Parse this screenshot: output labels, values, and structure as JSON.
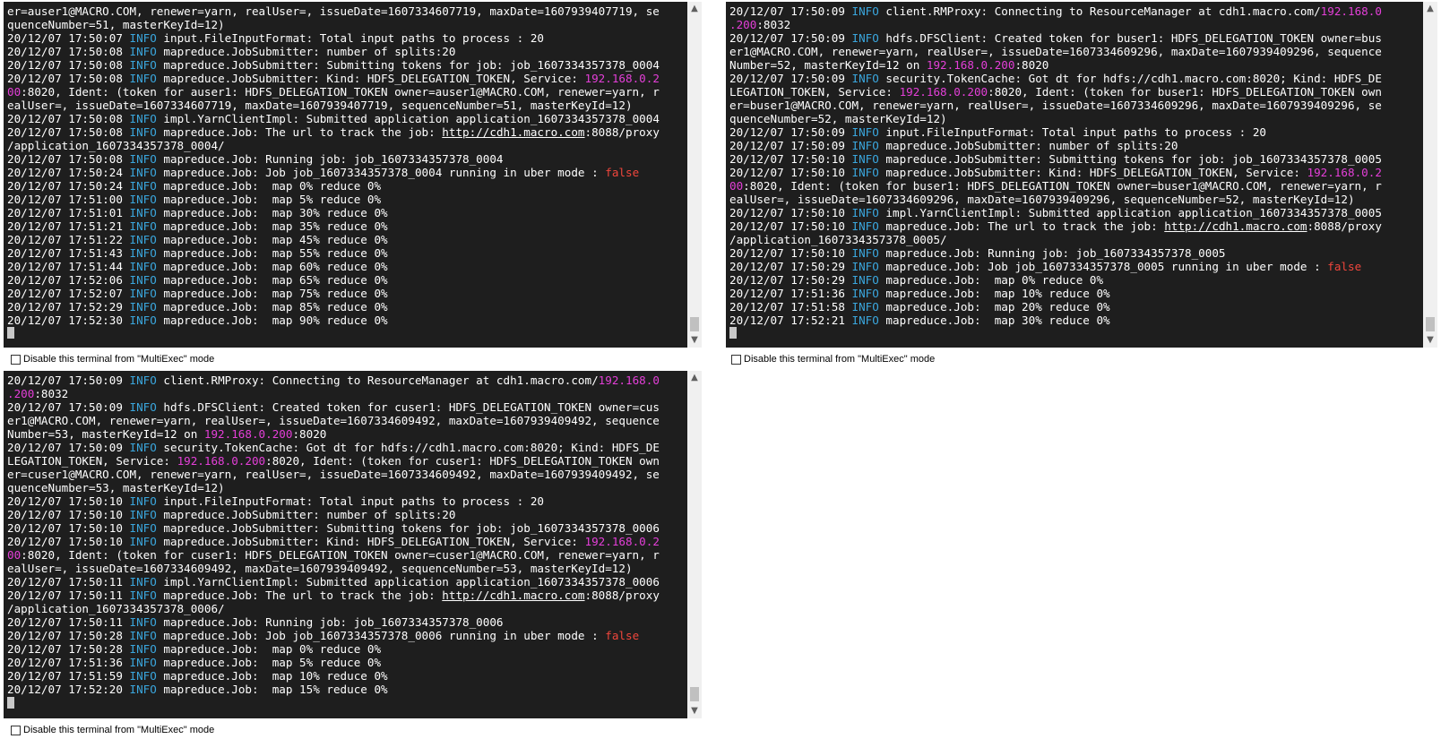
{
  "checkbox_label": "Disable this terminal from \"MultiExec\" mode",
  "terminals": [
    {
      "name": "terminal-1",
      "lines": [
        [
          [
            "t",
            "er=auser1@MACRO.COM, renewer=yarn, realUser=, issueDate=1607334607719, maxDate=1607939407719, se"
          ]
        ],
        [
          [
            "t",
            "quenceNumber=51, masterKeyId=12)"
          ]
        ],
        [
          [
            "t",
            "20/12/07 17:50:07 "
          ],
          [
            "i",
            "INFO"
          ],
          [
            "t",
            " input.FileInputFormat: Total input paths to process : 20"
          ]
        ],
        [
          [
            "t",
            "20/12/07 17:50:08 "
          ],
          [
            "i",
            "INFO"
          ],
          [
            "t",
            " mapreduce.JobSubmitter: number of splits:20"
          ]
        ],
        [
          [
            "t",
            "20/12/07 17:50:08 "
          ],
          [
            "i",
            "INFO"
          ],
          [
            "t",
            " mapreduce.JobSubmitter: Submitting tokens for job: job_1607334357378_0004"
          ]
        ],
        [
          [
            "t",
            "20/12/07 17:50:08 "
          ],
          [
            "i",
            "INFO"
          ],
          [
            "t",
            " mapreduce.JobSubmitter: Kind: HDFS_DELEGATION_TOKEN, Service: "
          ],
          [
            "p",
            "192.168.0.2"
          ]
        ],
        [
          [
            "p",
            "00"
          ],
          [
            "t",
            ":8020, Ident: (token for auser1: HDFS_DELEGATION_TOKEN owner=auser1@MACRO.COM, renewer=yarn, r"
          ]
        ],
        [
          [
            "t",
            "ealUser=, issueDate=1607334607719, maxDate=1607939407719, sequenceNumber=51, masterKeyId=12)"
          ]
        ],
        [
          [
            "t",
            "20/12/07 17:50:08 "
          ],
          [
            "i",
            "INFO"
          ],
          [
            "t",
            " impl.YarnClientImpl: Submitted application application_1607334357378_0004"
          ]
        ],
        [
          [
            "t",
            "20/12/07 17:50:08 "
          ],
          [
            "i",
            "INFO"
          ],
          [
            "t",
            " mapreduce.Job: The url to track the job: "
          ],
          [
            "u",
            "http://cdh1.macro.com"
          ],
          [
            "t",
            ":8088/proxy"
          ]
        ],
        [
          [
            "t",
            "/application_1607334357378_0004/"
          ]
        ],
        [
          [
            "t",
            "20/12/07 17:50:08 "
          ],
          [
            "i",
            "INFO"
          ],
          [
            "t",
            " mapreduce.Job: Running job: job_1607334357378_0004"
          ]
        ],
        [
          [
            "t",
            "20/12/07 17:50:24 "
          ],
          [
            "i",
            "INFO"
          ],
          [
            "t",
            " mapreduce.Job: Job job_1607334357378_0004 running in uber mode : "
          ],
          [
            "f",
            "false"
          ]
        ],
        [
          [
            "t",
            "20/12/07 17:50:24 "
          ],
          [
            "i",
            "INFO"
          ],
          [
            "t",
            " mapreduce.Job:  map 0% reduce 0%"
          ]
        ],
        [
          [
            "t",
            "20/12/07 17:51:00 "
          ],
          [
            "i",
            "INFO"
          ],
          [
            "t",
            " mapreduce.Job:  map 5% reduce 0%"
          ]
        ],
        [
          [
            "t",
            "20/12/07 17:51:01 "
          ],
          [
            "i",
            "INFO"
          ],
          [
            "t",
            " mapreduce.Job:  map 30% reduce 0%"
          ]
        ],
        [
          [
            "t",
            "20/12/07 17:51:21 "
          ],
          [
            "i",
            "INFO"
          ],
          [
            "t",
            " mapreduce.Job:  map 35% reduce 0%"
          ]
        ],
        [
          [
            "t",
            "20/12/07 17:51:22 "
          ],
          [
            "i",
            "INFO"
          ],
          [
            "t",
            " mapreduce.Job:  map 45% reduce 0%"
          ]
        ],
        [
          [
            "t",
            "20/12/07 17:51:43 "
          ],
          [
            "i",
            "INFO"
          ],
          [
            "t",
            " mapreduce.Job:  map 55% reduce 0%"
          ]
        ],
        [
          [
            "t",
            "20/12/07 17:51:44 "
          ],
          [
            "i",
            "INFO"
          ],
          [
            "t",
            " mapreduce.Job:  map 60% reduce 0%"
          ]
        ],
        [
          [
            "t",
            "20/12/07 17:52:06 "
          ],
          [
            "i",
            "INFO"
          ],
          [
            "t",
            " mapreduce.Job:  map 65% reduce 0%"
          ]
        ],
        [
          [
            "t",
            "20/12/07 17:52:07 "
          ],
          [
            "i",
            "INFO"
          ],
          [
            "t",
            " mapreduce.Job:  map 75% reduce 0%"
          ]
        ],
        [
          [
            "t",
            "20/12/07 17:52:29 "
          ],
          [
            "i",
            "INFO"
          ],
          [
            "t",
            " mapreduce.Job:  map 85% reduce 0%"
          ]
        ],
        [
          [
            "t",
            "20/12/07 17:52:30 "
          ],
          [
            "i",
            "INFO"
          ],
          [
            "t",
            " mapreduce.Job:  map 90% reduce 0%"
          ]
        ]
      ]
    },
    {
      "name": "terminal-2",
      "lines": [
        [
          [
            "t",
            "20/12/07 17:50:09 "
          ],
          [
            "i",
            "INFO"
          ],
          [
            "t",
            " client.RMProxy: Connecting to ResourceManager at cdh1.macro.com/"
          ],
          [
            "p",
            "192.168.0"
          ]
        ],
        [
          [
            "p",
            ".200"
          ],
          [
            "t",
            ":8032"
          ]
        ],
        [
          [
            "t",
            "20/12/07 17:50:09 "
          ],
          [
            "i",
            "INFO"
          ],
          [
            "t",
            " hdfs.DFSClient: Created token for buser1: HDFS_DELEGATION_TOKEN owner=bus"
          ]
        ],
        [
          [
            "t",
            "er1@MACRO.COM, renewer=yarn, realUser=, issueDate=1607334609296, maxDate=1607939409296, sequence"
          ]
        ],
        [
          [
            "t",
            "Number=52, masterKeyId=12 on "
          ],
          [
            "p",
            "192.168.0.200"
          ],
          [
            "t",
            ":8020"
          ]
        ],
        [
          [
            "t",
            "20/12/07 17:50:09 "
          ],
          [
            "i",
            "INFO"
          ],
          [
            "t",
            " security.TokenCache: Got dt for hdfs://cdh1.macro.com:8020; Kind: HDFS_DE"
          ]
        ],
        [
          [
            "t",
            "LEGATION_TOKEN, Service: "
          ],
          [
            "p",
            "192.168.0.200"
          ],
          [
            "t",
            ":8020, Ident: (token for buser1: HDFS_DELEGATION_TOKEN own"
          ]
        ],
        [
          [
            "t",
            "er=buser1@MACRO.COM, renewer=yarn, realUser=, issueDate=1607334609296, maxDate=1607939409296, se"
          ]
        ],
        [
          [
            "t",
            "quenceNumber=52, masterKeyId=12)"
          ]
        ],
        [
          [
            "t",
            "20/12/07 17:50:09 "
          ],
          [
            "i",
            "INFO"
          ],
          [
            "t",
            " input.FileInputFormat: Total input paths to process : 20"
          ]
        ],
        [
          [
            "t",
            "20/12/07 17:50:09 "
          ],
          [
            "i",
            "INFO"
          ],
          [
            "t",
            " mapreduce.JobSubmitter: number of splits:20"
          ]
        ],
        [
          [
            "t",
            "20/12/07 17:50:10 "
          ],
          [
            "i",
            "INFO"
          ],
          [
            "t",
            " mapreduce.JobSubmitter: Submitting tokens for job: job_1607334357378_0005"
          ]
        ],
        [
          [
            "t",
            "20/12/07 17:50:10 "
          ],
          [
            "i",
            "INFO"
          ],
          [
            "t",
            " mapreduce.JobSubmitter: Kind: HDFS_DELEGATION_TOKEN, Service: "
          ],
          [
            "p",
            "192.168.0.2"
          ]
        ],
        [
          [
            "p",
            "00"
          ],
          [
            "t",
            ":8020, Ident: (token for buser1: HDFS_DELEGATION_TOKEN owner=buser1@MACRO.COM, renewer=yarn, r"
          ]
        ],
        [
          [
            "t",
            "ealUser=, issueDate=1607334609296, maxDate=1607939409296, sequenceNumber=52, masterKeyId=12)"
          ]
        ],
        [
          [
            "t",
            "20/12/07 17:50:10 "
          ],
          [
            "i",
            "INFO"
          ],
          [
            "t",
            " impl.YarnClientImpl: Submitted application application_1607334357378_0005"
          ]
        ],
        [
          [
            "t",
            "20/12/07 17:50:10 "
          ],
          [
            "i",
            "INFO"
          ],
          [
            "t",
            " mapreduce.Job: The url to track the job: "
          ],
          [
            "u",
            "http://cdh1.macro.com"
          ],
          [
            "t",
            ":8088/proxy"
          ]
        ],
        [
          [
            "t",
            "/application_1607334357378_0005/"
          ]
        ],
        [
          [
            "t",
            "20/12/07 17:50:10 "
          ],
          [
            "i",
            "INFO"
          ],
          [
            "t",
            " mapreduce.Job: Running job: job_1607334357378_0005"
          ]
        ],
        [
          [
            "t",
            "20/12/07 17:50:29 "
          ],
          [
            "i",
            "INFO"
          ],
          [
            "t",
            " mapreduce.Job: Job job_1607334357378_0005 running in uber mode : "
          ],
          [
            "f",
            "false"
          ]
        ],
        [
          [
            "t",
            "20/12/07 17:50:29 "
          ],
          [
            "i",
            "INFO"
          ],
          [
            "t",
            " mapreduce.Job:  map 0% reduce 0%"
          ]
        ],
        [
          [
            "t",
            "20/12/07 17:51:36 "
          ],
          [
            "i",
            "INFO"
          ],
          [
            "t",
            " mapreduce.Job:  map 10% reduce 0%"
          ]
        ],
        [
          [
            "t",
            "20/12/07 17:51:58 "
          ],
          [
            "i",
            "INFO"
          ],
          [
            "t",
            " mapreduce.Job:  map 20% reduce 0%"
          ]
        ],
        [
          [
            "t",
            "20/12/07 17:52:21 "
          ],
          [
            "i",
            "INFO"
          ],
          [
            "t",
            " mapreduce.Job:  map 30% reduce 0%"
          ]
        ]
      ]
    },
    {
      "name": "terminal-3",
      "lines": [
        [
          [
            "t",
            "20/12/07 17:50:09 "
          ],
          [
            "i",
            "INFO"
          ],
          [
            "t",
            " client.RMProxy: Connecting to ResourceManager at cdh1.macro.com/"
          ],
          [
            "p",
            "192.168.0"
          ]
        ],
        [
          [
            "p",
            ".200"
          ],
          [
            "t",
            ":8032"
          ]
        ],
        [
          [
            "t",
            "20/12/07 17:50:09 "
          ],
          [
            "i",
            "INFO"
          ],
          [
            "t",
            " hdfs.DFSClient: Created token for cuser1: HDFS_DELEGATION_TOKEN owner=cus"
          ]
        ],
        [
          [
            "t",
            "er1@MACRO.COM, renewer=yarn, realUser=, issueDate=1607334609492, maxDate=1607939409492, sequence"
          ]
        ],
        [
          [
            "t",
            "Number=53, masterKeyId=12 on "
          ],
          [
            "p",
            "192.168.0.200"
          ],
          [
            "t",
            ":8020"
          ]
        ],
        [
          [
            "t",
            "20/12/07 17:50:09 "
          ],
          [
            "i",
            "INFO"
          ],
          [
            "t",
            " security.TokenCache: Got dt for hdfs://cdh1.macro.com:8020; Kind: HDFS_DE"
          ]
        ],
        [
          [
            "t",
            "LEGATION_TOKEN, Service: "
          ],
          [
            "p",
            "192.168.0.200"
          ],
          [
            "t",
            ":8020, Ident: (token for cuser1: HDFS_DELEGATION_TOKEN own"
          ]
        ],
        [
          [
            "t",
            "er=cuser1@MACRO.COM, renewer=yarn, realUser=, issueDate=1607334609492, maxDate=1607939409492, se"
          ]
        ],
        [
          [
            "t",
            "quenceNumber=53, masterKeyId=12)"
          ]
        ],
        [
          [
            "t",
            "20/12/07 17:50:10 "
          ],
          [
            "i",
            "INFO"
          ],
          [
            "t",
            " input.FileInputFormat: Total input paths to process : 20"
          ]
        ],
        [
          [
            "t",
            "20/12/07 17:50:10 "
          ],
          [
            "i",
            "INFO"
          ],
          [
            "t",
            " mapreduce.JobSubmitter: number of splits:20"
          ]
        ],
        [
          [
            "t",
            "20/12/07 17:50:10 "
          ],
          [
            "i",
            "INFO"
          ],
          [
            "t",
            " mapreduce.JobSubmitter: Submitting tokens for job: job_1607334357378_0006"
          ]
        ],
        [
          [
            "t",
            "20/12/07 17:50:10 "
          ],
          [
            "i",
            "INFO"
          ],
          [
            "t",
            " mapreduce.JobSubmitter: Kind: HDFS_DELEGATION_TOKEN, Service: "
          ],
          [
            "p",
            "192.168.0.2"
          ]
        ],
        [
          [
            "p",
            "00"
          ],
          [
            "t",
            ":8020, Ident: (token for cuser1: HDFS_DELEGATION_TOKEN owner=cuser1@MACRO.COM, renewer=yarn, r"
          ]
        ],
        [
          [
            "t",
            "ealUser=, issueDate=1607334609492, maxDate=1607939409492, sequenceNumber=53, masterKeyId=12)"
          ]
        ],
        [
          [
            "t",
            "20/12/07 17:50:11 "
          ],
          [
            "i",
            "INFO"
          ],
          [
            "t",
            " impl.YarnClientImpl: Submitted application application_1607334357378_0006"
          ]
        ],
        [
          [
            "t",
            "20/12/07 17:50:11 "
          ],
          [
            "i",
            "INFO"
          ],
          [
            "t",
            " mapreduce.Job: The url to track the job: "
          ],
          [
            "u",
            "http://cdh1.macro.com"
          ],
          [
            "t",
            ":8088/proxy"
          ]
        ],
        [
          [
            "t",
            "/application_1607334357378_0006/"
          ]
        ],
        [
          [
            "t",
            "20/12/07 17:50:11 "
          ],
          [
            "i",
            "INFO"
          ],
          [
            "t",
            " mapreduce.Job: Running job: job_1607334357378_0006"
          ]
        ],
        [
          [
            "t",
            "20/12/07 17:50:28 "
          ],
          [
            "i",
            "INFO"
          ],
          [
            "t",
            " mapreduce.Job: Job job_1607334357378_0006 running in uber mode : "
          ],
          [
            "f",
            "false"
          ]
        ],
        [
          [
            "t",
            "20/12/07 17:50:28 "
          ],
          [
            "i",
            "INFO"
          ],
          [
            "t",
            " mapreduce.Job:  map 0% reduce 0%"
          ]
        ],
        [
          [
            "t",
            "20/12/07 17:51:36 "
          ],
          [
            "i",
            "INFO"
          ],
          [
            "t",
            " mapreduce.Job:  map 5% reduce 0%"
          ]
        ],
        [
          [
            "t",
            "20/12/07 17:51:59 "
          ],
          [
            "i",
            "INFO"
          ],
          [
            "t",
            " mapreduce.Job:  map 10% reduce 0%"
          ]
        ],
        [
          [
            "t",
            "20/12/07 17:52:20 "
          ],
          [
            "i",
            "INFO"
          ],
          [
            "t",
            " mapreduce.Job:  map 15% reduce 0%"
          ]
        ]
      ]
    }
  ],
  "colors": {
    "background": "#1e1e1e",
    "text": "#ffffff",
    "info": "#3aa6dd",
    "ip": "#e43fd8",
    "false": "#f0463c"
  }
}
